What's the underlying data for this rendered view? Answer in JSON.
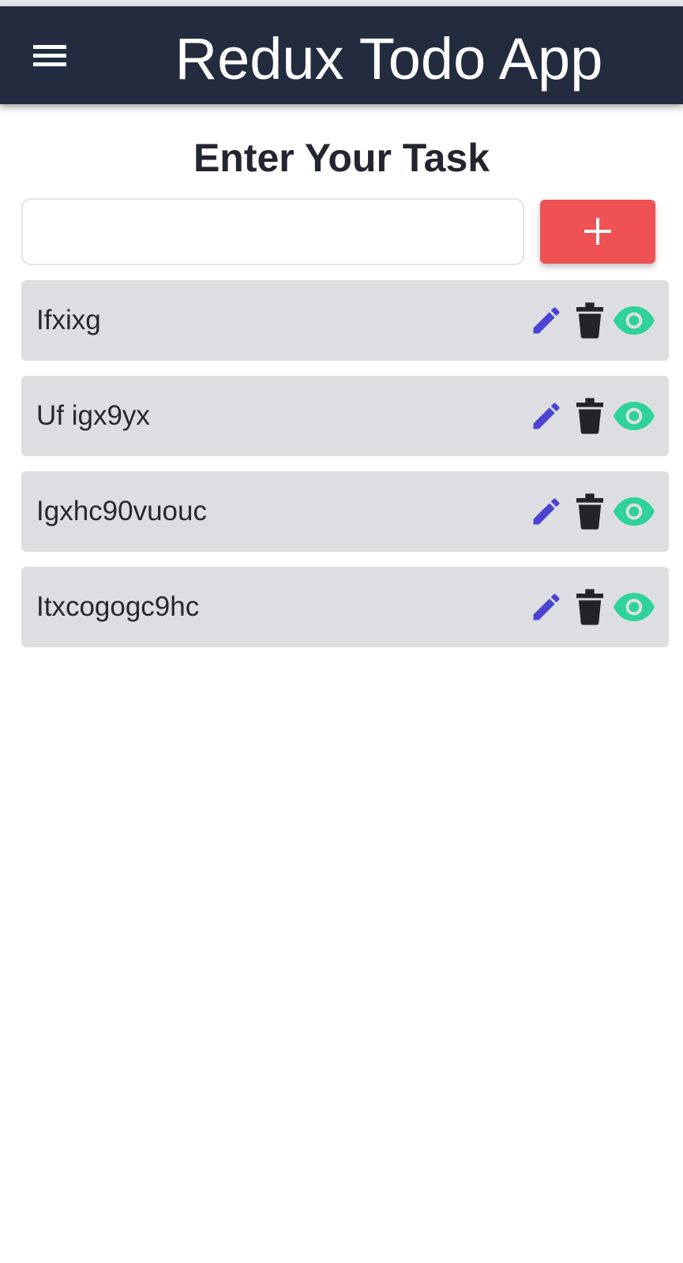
{
  "header": {
    "title": "Redux Todo App",
    "menu_icon": "menu-icon"
  },
  "main": {
    "heading": "Enter Your Task",
    "input": {
      "value": "",
      "placeholder": ""
    },
    "add_button_icon": "plus-icon",
    "tasks": [
      {
        "text": "Ifxixg"
      },
      {
        "text": "Uf igx9yx"
      },
      {
        "text": "Igxhc90vuouc"
      },
      {
        "text": "Itxcogogc9hc"
      }
    ],
    "task_actions": [
      "pencil-icon",
      "trash-icon",
      "eye-icon"
    ]
  },
  "colors": {
    "app_bar": "#222c3e",
    "add_button": "#ee5254",
    "task_background": "#dddee2",
    "edit_icon": "#4a45d0",
    "delete_icon": "#23242a",
    "view_icon": "#2fd29b"
  }
}
